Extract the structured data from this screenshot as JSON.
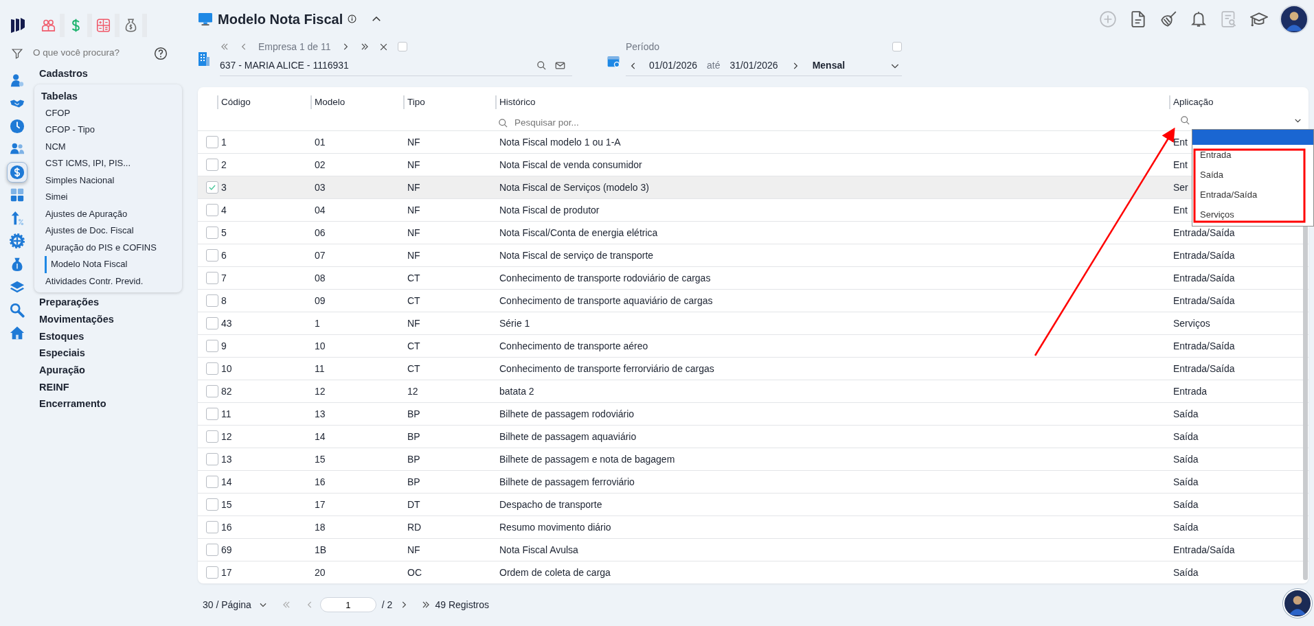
{
  "app": {
    "top_tabs": [
      {
        "kind": "people"
      },
      {
        "kind": "dollar"
      },
      {
        "kind": "calculator"
      },
      {
        "kind": "money-bag"
      }
    ]
  },
  "sidebar": {
    "search": {
      "placeholder": "O que você procura?"
    },
    "rail": [
      {
        "kind": "user-gear",
        "selected": false
      },
      {
        "kind": "handshake",
        "selected": false
      },
      {
        "kind": "clock",
        "selected": false
      },
      {
        "kind": "users",
        "selected": false
      },
      {
        "kind": "dollar",
        "selected": true
      },
      {
        "kind": "calculator",
        "selected": false
      },
      {
        "kind": "arrow-percent",
        "selected": false
      },
      {
        "kind": "gear",
        "selected": false
      },
      {
        "kind": "money-bag",
        "selected": false
      },
      {
        "kind": "layers",
        "selected": false
      },
      {
        "kind": "search",
        "selected": false
      },
      {
        "kind": "home",
        "selected": false
      }
    ],
    "menu": [
      {
        "label": "Cadastros",
        "expanded": false
      },
      {
        "label": "Tabelas",
        "expanded": true,
        "children": [
          {
            "label": "CFOP",
            "selected": false
          },
          {
            "label": "CFOP - Tipo",
            "selected": false
          },
          {
            "label": "NCM",
            "selected": false
          },
          {
            "label": "CST ICMS, IPI, PIS...",
            "selected": false
          },
          {
            "label": "Simples Nacional",
            "selected": false
          },
          {
            "label": "Simei",
            "selected": false
          },
          {
            "label": "Ajustes de Apuração",
            "selected": false
          },
          {
            "label": "Ajustes de Doc. Fiscal",
            "selected": false
          },
          {
            "label": "Apuração do PIS e COFINS",
            "selected": false
          },
          {
            "label": "Modelo Nota Fiscal",
            "selected": true
          },
          {
            "label": "Atividades Contr. Previd.",
            "selected": false
          }
        ]
      },
      {
        "label": "Preparações",
        "expanded": false
      },
      {
        "label": "Movimentações",
        "expanded": false
      },
      {
        "label": "Estoques",
        "expanded": false
      },
      {
        "label": "Especiais",
        "expanded": false
      },
      {
        "label": "Apuração",
        "expanded": false
      },
      {
        "label": "REINF",
        "expanded": false
      },
      {
        "label": "Encerramento",
        "expanded": false
      }
    ]
  },
  "header": {
    "title": "Modelo Nota Fiscal",
    "toolbar": [
      {
        "kind": "plus-circle",
        "disabled": true
      },
      {
        "kind": "document",
        "disabled": false
      },
      {
        "kind": "broom",
        "disabled": false
      },
      {
        "kind": "bell",
        "disabled": false
      },
      {
        "kind": "document-search",
        "disabled": true
      },
      {
        "kind": "graduation-cap",
        "disabled": false
      }
    ]
  },
  "empresa": {
    "nav": "Empresa 1 de 11",
    "value": "637 - MARIA ALICE - 1116931",
    "checked": false
  },
  "periodo": {
    "label": "Período",
    "start": "01/01/2026",
    "separator": "até",
    "end": "31/01/2026",
    "mode": "Mensal",
    "checked": false
  },
  "table": {
    "columns": [
      "Código",
      "Modelo",
      "Tipo",
      "Histórico",
      "Aplicação"
    ],
    "search_placeholder": "Pesquisar por...",
    "rows": [
      {
        "cells": [
          "1",
          "01",
          "NF",
          "Nota Fiscal modelo 1 ou 1-A",
          "Ent"
        ],
        "selected": false
      },
      {
        "cells": [
          "2",
          "02",
          "NF",
          "Nota Fiscal de venda consumidor",
          "Ent"
        ],
        "selected": false
      },
      {
        "cells": [
          "3",
          "03",
          "NF",
          "Nota Fiscal de Serviços (modelo 3)",
          "Ser"
        ],
        "selected": true
      },
      {
        "cells": [
          "4",
          "04",
          "NF",
          "Nota Fiscal de produtor",
          "Ent"
        ],
        "selected": false
      },
      {
        "cells": [
          "5",
          "06",
          "NF",
          "Nota Fiscal/Conta de energia elétrica",
          "Entrada/Saída"
        ],
        "selected": false
      },
      {
        "cells": [
          "6",
          "07",
          "NF",
          "Nota Fiscal de serviço de transporte",
          "Entrada/Saída"
        ],
        "selected": false
      },
      {
        "cells": [
          "7",
          "08",
          "CT",
          "Conhecimento de transporte rodoviário de cargas",
          "Entrada/Saída"
        ],
        "selected": false
      },
      {
        "cells": [
          "8",
          "09",
          "CT",
          "Conhecimento de transporte aquaviário de cargas",
          "Entrada/Saída"
        ],
        "selected": false
      },
      {
        "cells": [
          "43",
          "1",
          "NF",
          "Série 1",
          "Serviços"
        ],
        "selected": false
      },
      {
        "cells": [
          "9",
          "10",
          "CT",
          "Conhecimento de transporte aéreo",
          "Entrada/Saída"
        ],
        "selected": false
      },
      {
        "cells": [
          "10",
          "11",
          "CT",
          "Conhecimento de transporte ferrorviário de cargas",
          "Entrada/Saída"
        ],
        "selected": false
      },
      {
        "cells": [
          "82",
          "12",
          "12",
          "batata 2",
          "Entrada"
        ],
        "selected": false
      },
      {
        "cells": [
          "11",
          "13",
          "BP",
          "Bilhete de passagem rodoviário",
          "Saída"
        ],
        "selected": false
      },
      {
        "cells": [
          "12",
          "14",
          "BP",
          "Bilhete de passagem aquaviário",
          "Saída"
        ],
        "selected": false
      },
      {
        "cells": [
          "13",
          "15",
          "BP",
          "Bilhete de passagem e nota de bagagem",
          "Saída"
        ],
        "selected": false
      },
      {
        "cells": [
          "14",
          "16",
          "BP",
          "Bilhete de passagem ferroviário",
          "Saída"
        ],
        "selected": false
      },
      {
        "cells": [
          "15",
          "17",
          "DT",
          "Despacho de transporte",
          "Saída"
        ],
        "selected": false
      },
      {
        "cells": [
          "16",
          "18",
          "RD",
          "Resumo movimento diário",
          "Saída"
        ],
        "selected": false
      },
      {
        "cells": [
          "69",
          "1B",
          "NF",
          "Nota Fiscal Avulsa",
          "Entrada/Saída"
        ],
        "selected": false
      },
      {
        "cells": [
          "17",
          "20",
          "OC",
          "Ordem de coleta de carga",
          "Saída"
        ],
        "selected": false
      }
    ]
  },
  "filter_dropdown": {
    "blank_selected": true,
    "options": [
      "Entrada",
      "Saída",
      "Entrada/Saída",
      "Serviços"
    ]
  },
  "pagination": {
    "page_size": "30 / Página",
    "page": "1",
    "total_pages": "/ 2",
    "records": "49 Registros"
  }
}
